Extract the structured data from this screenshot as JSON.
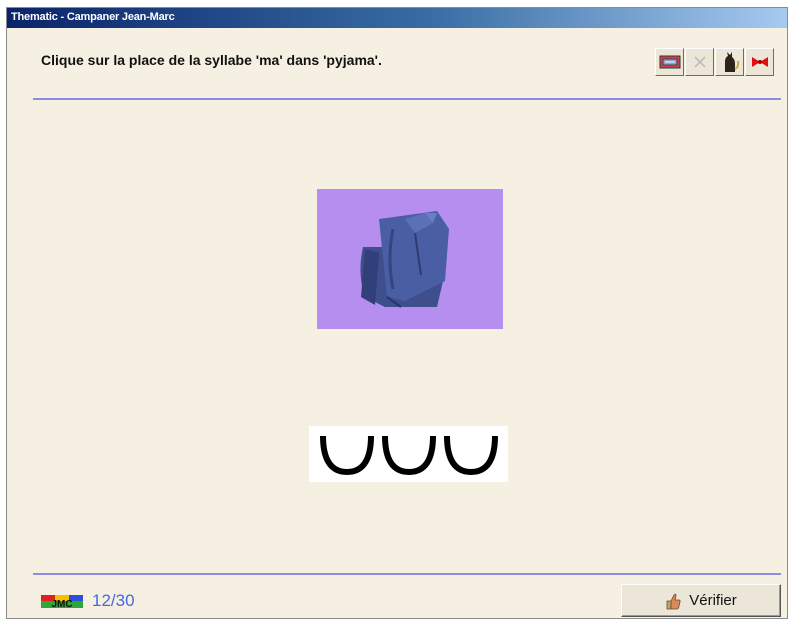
{
  "window": {
    "title": "Thematic - Campaner Jean-Marc"
  },
  "instruction": "Clique sur la place de la syllabe 'ma' dans 'pyjama'.",
  "toolbar": {
    "icons": [
      "ticket-icon",
      "close-x-icon",
      "cat-icon",
      "bow-icon"
    ]
  },
  "picture": {
    "icon": "folded-shirt-image",
    "background": "#b58ef0"
  },
  "syllables": {
    "count": 3,
    "icon": "syllable-arc"
  },
  "footer": {
    "logo_text": "JMC",
    "progress": "12/30",
    "verify_label": "Vérifier"
  },
  "colors": {
    "background": "#f6f0e3",
    "rule": "#8a8ee0",
    "progress_text": "#4a67e0"
  }
}
